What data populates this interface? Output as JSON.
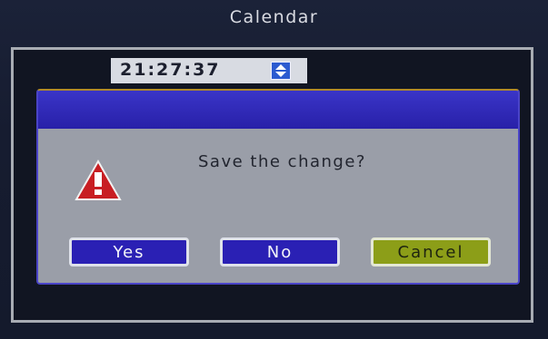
{
  "window": {
    "title": "Calendar"
  },
  "time_field": {
    "value": "21:27:37",
    "spinner_icon": "up-down-arrows-icon"
  },
  "dialog": {
    "message": "Save the change?",
    "icon": "warning-triangle-icon",
    "buttons": {
      "yes": "Yes",
      "no": "No",
      "cancel": "Cancel"
    }
  },
  "colors": {
    "dialog_bar": "#2820a8",
    "button_primary": "#2a20b4",
    "button_cancel": "#8c9e18",
    "warning_red": "#c81e23"
  }
}
